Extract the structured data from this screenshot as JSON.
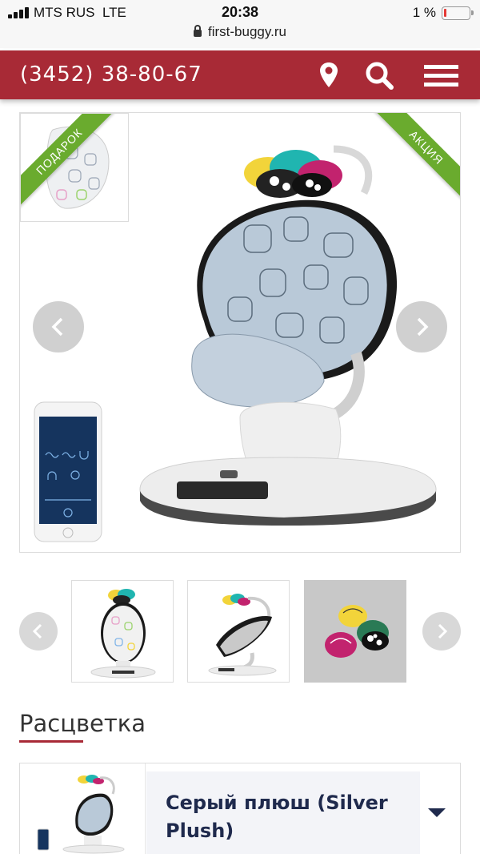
{
  "status_bar": {
    "carrier": "MTS RUS",
    "network": "LTE",
    "time": "20:38",
    "battery": "1 %"
  },
  "browser": {
    "url": "first-buggy.ru"
  },
  "header": {
    "phone": "(3452) 38-80-67",
    "icons": [
      "location-pin-icon",
      "search-icon",
      "menu-icon"
    ],
    "background_color": "#a82a36"
  },
  "product_gallery": {
    "gift_badge": "ПОДАРОК",
    "sale_badge": "АКЦИЯ",
    "badge_color": "#6aab2e"
  },
  "color_section": {
    "title": "Расцветка",
    "selected_color": "Серый плюш (Silver Plush)"
  }
}
